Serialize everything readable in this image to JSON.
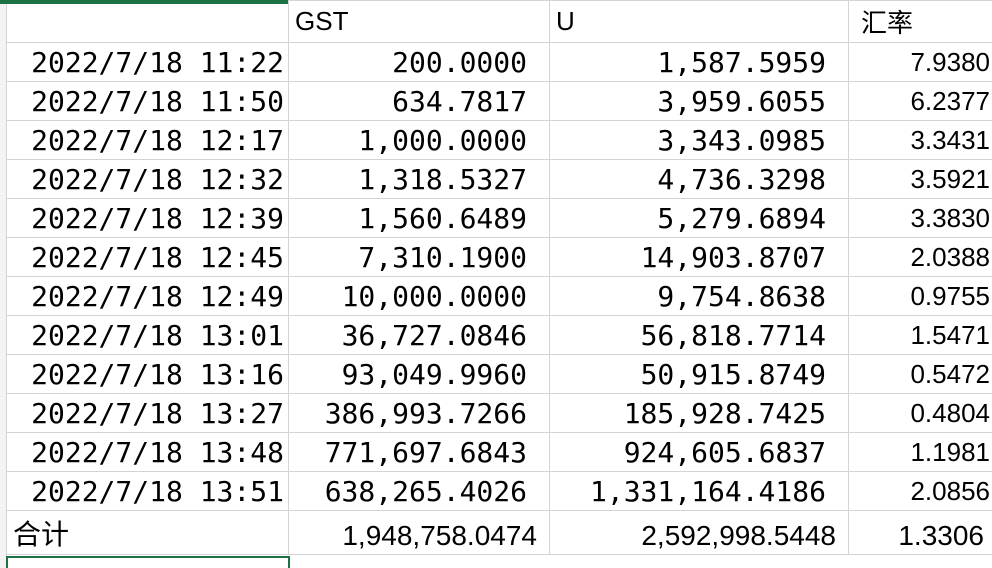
{
  "headers": [
    "",
    "GST",
    "U",
    "汇率"
  ],
  "rows": [
    {
      "time": "2022/7/18 11:22",
      "gst": "200.0000",
      "u": "1,587.5959",
      "rate": "7.9380"
    },
    {
      "time": "2022/7/18 11:50",
      "gst": "634.7817",
      "u": "3,959.6055",
      "rate": "6.2377"
    },
    {
      "time": "2022/7/18 12:17",
      "gst": "1,000.0000",
      "u": "3,343.0985",
      "rate": "3.3431"
    },
    {
      "time": "2022/7/18 12:32",
      "gst": "1,318.5327",
      "u": "4,736.3298",
      "rate": "3.5921"
    },
    {
      "time": "2022/7/18 12:39",
      "gst": "1,560.6489",
      "u": "5,279.6894",
      "rate": "3.3830"
    },
    {
      "time": "2022/7/18 12:45",
      "gst": "7,310.1900",
      "u": "14,903.8707",
      "rate": "2.0388"
    },
    {
      "time": "2022/7/18 12:49",
      "gst": "10,000.0000",
      "u": "9,754.8638",
      "rate": "0.9755"
    },
    {
      "time": "2022/7/18 13:01",
      "gst": "36,727.0846",
      "u": "56,818.7714",
      "rate": "1.5471"
    },
    {
      "time": "2022/7/18 13:16",
      "gst": "93,049.9960",
      "u": "50,915.8749",
      "rate": "0.5472"
    },
    {
      "time": "2022/7/18 13:27",
      "gst": "386,993.7266",
      "u": "185,928.7425",
      "rate": "0.4804"
    },
    {
      "time": "2022/7/18 13:48",
      "gst": "771,697.6843",
      "u": "924,605.6837",
      "rate": "1.1981"
    },
    {
      "time": "2022/7/18 13:51",
      "gst": "638,265.4026",
      "u": "1,331,164.4186",
      "rate": "2.0856"
    }
  ],
  "total": {
    "label": "合计",
    "gst": "1,948,758.0474",
    "u": "2,592,998.5448",
    "rate": "1.3306"
  },
  "colors": {
    "gridline": "#d4d4d4",
    "selection": "#1e7145",
    "header_strip": "#f3f3f3"
  }
}
